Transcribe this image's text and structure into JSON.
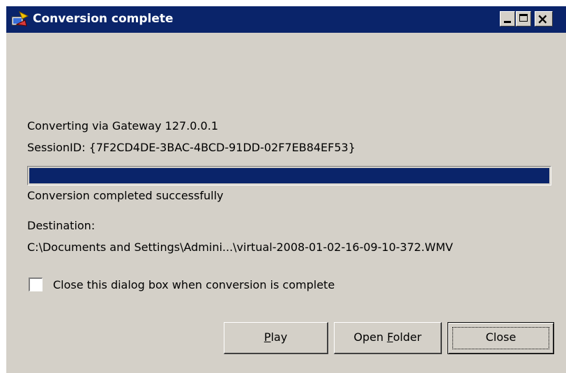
{
  "window": {
    "title": "Conversion complete",
    "icon": "converter-app-icon",
    "controls": {
      "minimize_icon": "minimize-icon",
      "maximize_icon": "maximize-icon",
      "close_glyph": "×"
    },
    "title_bar_color": "#0a246a"
  },
  "status": {
    "gateway_line": "Converting via Gateway 127.0.0.1",
    "session_line": "SessionID: {7F2CD4DE-3BAC-4BCD-91DD-02F7EB84EF53}",
    "progress_percent": 100,
    "progress_color": "#0a246a",
    "result_text": "Conversion completed successfully"
  },
  "destination": {
    "label": "Destination:",
    "path": "C:\\Documents and Settings\\Admini...\\virtual-2008-01-02-16-09-10-372.WMV"
  },
  "options": {
    "close_when_complete_label": "Close this dialog box when conversion is complete",
    "close_when_complete_checked": false
  },
  "buttons": {
    "play": {
      "mnemonic": "P",
      "rest": "lay"
    },
    "open_folder": {
      "before": "Open ",
      "mnemonic": "F",
      "rest": "older"
    },
    "close": {
      "label": "Close"
    }
  }
}
